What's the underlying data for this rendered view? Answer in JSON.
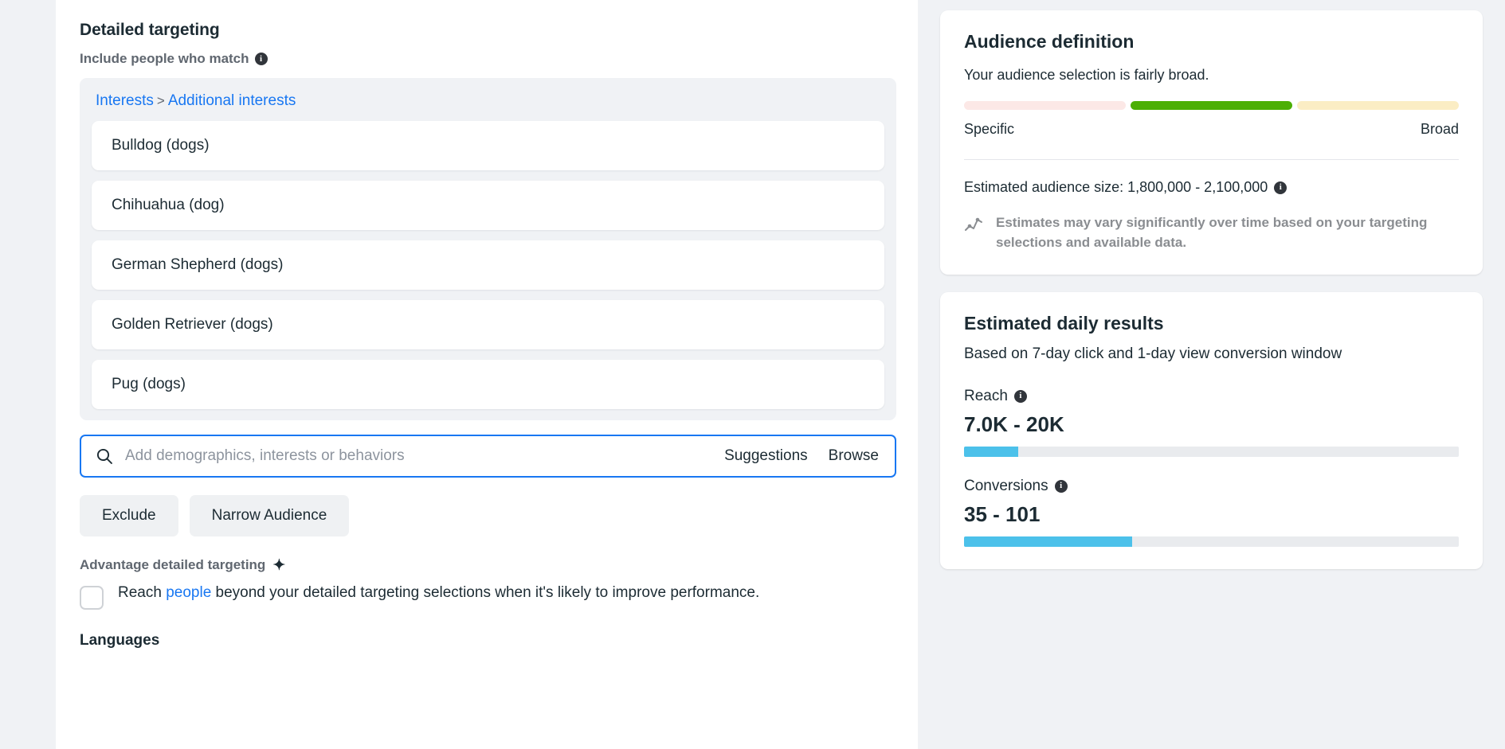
{
  "main": {
    "section_title": "Detailed targeting",
    "include_label": "Include people who match",
    "breadcrumb": {
      "root": "Interests",
      "separator": ">",
      "child": "Additional interests"
    },
    "interests": [
      "Bulldog (dogs)",
      "Chihuahua (dog)",
      "German Shepherd (dogs)",
      "Golden Retriever (dogs)",
      "Pug (dogs)"
    ],
    "search": {
      "placeholder": "Add demographics, interests or behaviors",
      "suggestions_label": "Suggestions",
      "browse_label": "Browse"
    },
    "buttons": {
      "exclude": "Exclude",
      "narrow_audience": "Narrow Audience"
    },
    "advantage": {
      "label": "Advantage detailed targeting",
      "sparkle": "✦",
      "text_before": "Reach ",
      "link": "people",
      "text_after": " beyond your detailed targeting selections when it's likely to improve performance."
    },
    "languages_title": "Languages"
  },
  "audience_definition": {
    "title": "Audience definition",
    "summary": "Your audience selection is fairly broad.",
    "gauge": {
      "segments": [
        {
          "name": "specific",
          "color": "#fce8e6"
        },
        {
          "name": "balanced",
          "color": "#4caf05"
        },
        {
          "name": "broad",
          "color": "#fbedc4"
        }
      ],
      "active_index": 1,
      "left_label": "Specific",
      "right_label": "Broad"
    },
    "estimated_audience_size": "Estimated audience size: 1,800,000 - 2,100,000",
    "estimate_note": "Estimates may vary significantly over time based on your targeting selections and available data."
  },
  "estimated_daily_results": {
    "title": "Estimated daily results",
    "subtitle": "Based on 7-day click and 1-day view conversion window",
    "metrics": [
      {
        "label": "Reach",
        "value": "7.0K - 20K",
        "fill_percent": 11,
        "color": "#4cc1ea"
      },
      {
        "label": "Conversions",
        "value": "35 - 101",
        "fill_percent": 34,
        "color": "#4cc1ea"
      }
    ]
  }
}
